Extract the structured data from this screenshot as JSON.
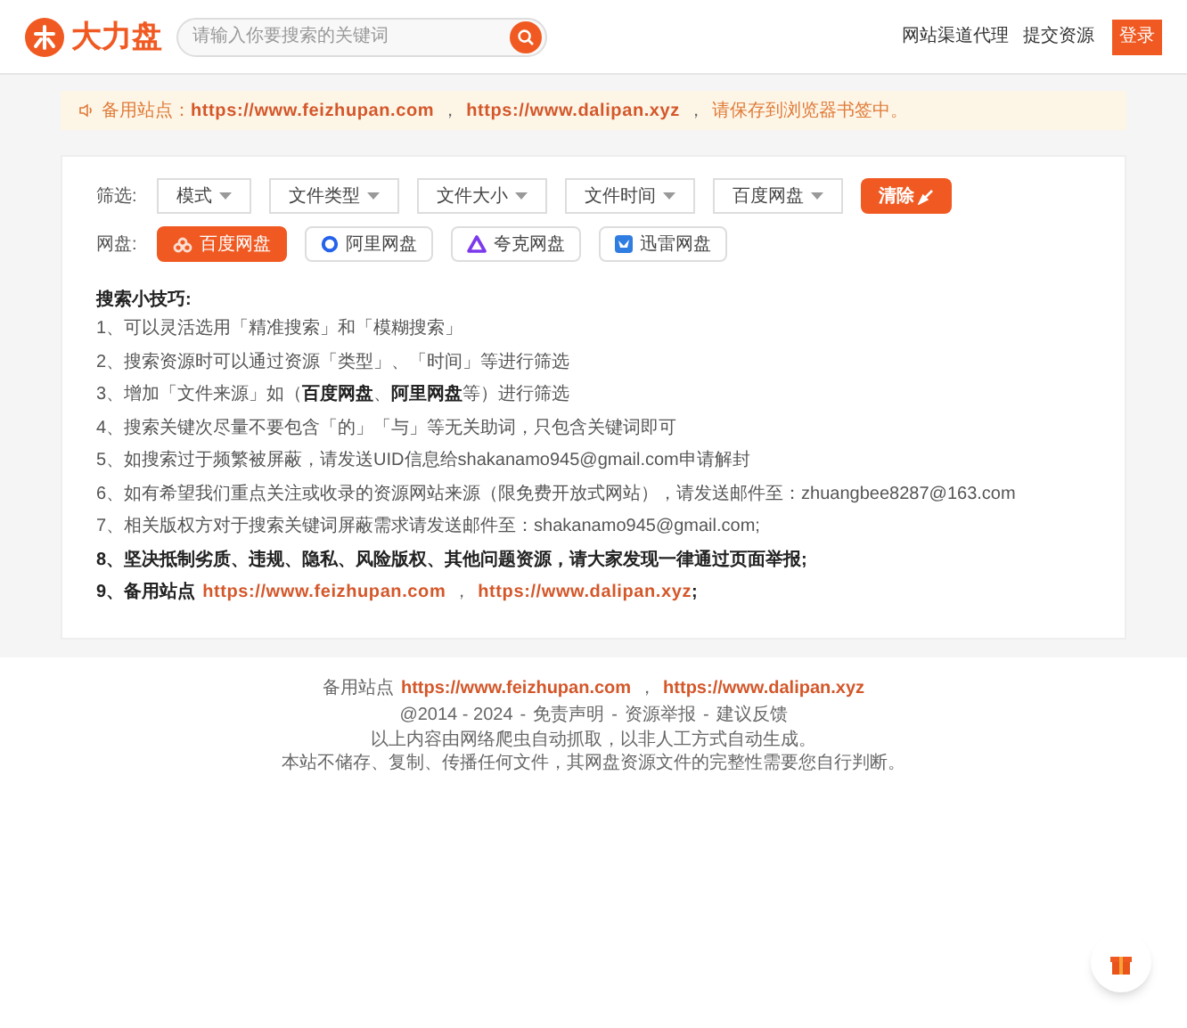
{
  "header": {
    "logo_text": "大力盘",
    "search": {
      "placeholder": "请输入你要搜索的关键词"
    },
    "nav": [
      "网站渠道代理",
      "提交资源"
    ],
    "login": "登录"
  },
  "notice": {
    "label": "备用站点：",
    "links": [
      "https://www.feizhupan.com",
      "https://www.dalipan.xyz"
    ],
    "separator": "，",
    "suffix": "请保存到浏览器书签中。"
  },
  "filters": {
    "label": "筛选:",
    "dropdowns": [
      "模式",
      "文件类型",
      "文件大小",
      "文件时间",
      "百度网盘"
    ],
    "clear": "清除"
  },
  "disks": {
    "label": "网盘:",
    "items": [
      {
        "label": "百度网盘",
        "selected": true,
        "kind": "baidu"
      },
      {
        "label": "阿里网盘",
        "selected": false,
        "kind": "ali"
      },
      {
        "label": "夸克网盘",
        "selected": false,
        "kind": "quark"
      },
      {
        "label": "迅雷网盘",
        "selected": false,
        "kind": "xunlei"
      }
    ]
  },
  "tips": {
    "title": "搜索小技巧:",
    "items": [
      {
        "kind": "plain",
        "text": "1、可以灵活选用「精准搜索」和「模糊搜索」"
      },
      {
        "kind": "plain",
        "text": "2、搜索资源时可以通过资源「类型」、「时间」等进行筛选"
      },
      {
        "kind": "plain",
        "text": "3、增加「文件来源」如（**百度网盘**、**阿里网盘**等）进行筛选"
      },
      {
        "kind": "plain",
        "text": "4、搜索关键次尽量不要包含「的」「与」等无关助词，只包含关键词即可"
      },
      {
        "kind": "plain",
        "text": "5、如搜索过于频繁被屏蔽，请发送UID信息给shakanamo945@gmail.com申请解封"
      },
      {
        "kind": "plain",
        "text": "6、如有希望我们重点关注或收录的资源网站来源（限免费开放式网站），请发送邮件至：zhuangbee8287@163.com"
      },
      {
        "kind": "plain",
        "text": "7、相关版权方对于搜索关键词屏蔽需求请发送邮件至：shakanamo945@gmail.com;"
      },
      {
        "kind": "plain",
        "text": "**8、坚决抵制劣质、违规、隐私、风险版权、其他问题资源，请大家发现一律通过页面举报;**"
      },
      {
        "kind": "sites",
        "text": "**9、备用站点**",
        "links": [
          "https://www.feizhupan.com",
          "https://www.dalipan.xyz"
        ],
        "separator": "，",
        "end": ";"
      }
    ]
  },
  "footer": {
    "sites_label": "备用站点",
    "links": [
      "https://www.feizhupan.com",
      "https://www.dalipan.xyz"
    ],
    "separator": "，",
    "meta_separator": "-",
    "meta": [
      "@2014 - 2024",
      "免责声明",
      "资源举报",
      "建议反馈"
    ],
    "lines": [
      "以上内容由网络爬虫自动抓取，以非人工方式自动生成。",
      "本站不储存、复制、传播任何文件，其网盘资源文件的完整性需要您自行判断。"
    ]
  }
}
